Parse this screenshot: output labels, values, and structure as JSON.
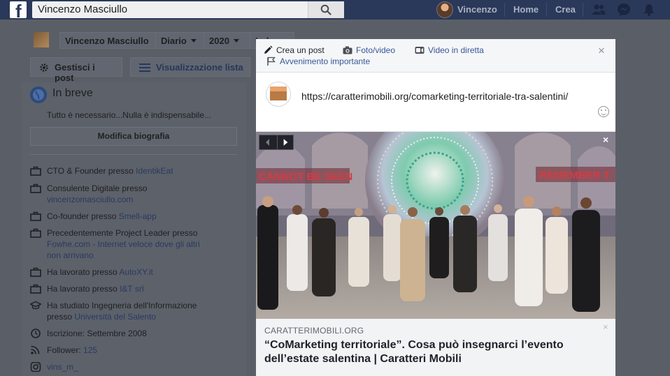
{
  "topbar": {
    "search_value": "Vincenzo Masciullo",
    "user_name": "Vincenzo",
    "home": "Home",
    "create": "Crea"
  },
  "profile": {
    "name": "Vincenzo Masciullo",
    "timeline": "Diario",
    "year": "2020",
    "more": "Ind",
    "manage_posts": "Gestisci i post",
    "list_view": "Visualizzazione lista"
  },
  "intro": {
    "title": "In breve",
    "bio": "Tutto è necessario...Nulla è indispensabile...",
    "edit_bio": "Modifica biografia",
    "items": [
      {
        "icon": "briefcase-icon",
        "text": "CTO & Founder presso ",
        "link": "IdentikEat"
      },
      {
        "icon": "briefcase-icon",
        "text": "Consulente Digitale presso",
        "link": "vincenzomasciullo.com"
      },
      {
        "icon": "briefcase-icon",
        "text": "Co-founder presso ",
        "link": "Smell-app"
      },
      {
        "icon": "briefcase-icon",
        "text": "Precedentemente Project Leader presso",
        "link": "Fowhe.com - Internet veloce dove gli altri non arrivano"
      },
      {
        "icon": "briefcase-icon",
        "text": "Ha lavorato presso ",
        "link": "AutoXY.it"
      },
      {
        "icon": "briefcase-icon",
        "text": "Ha lavorato presso ",
        "link": "I&T srl"
      },
      {
        "icon": "graduation-cap-icon",
        "text": "Ha studiato Ingegneria dell'Informazione presso ",
        "link": "Università del Salento"
      },
      {
        "icon": "clock-icon",
        "text": "Iscrizione: Settembre 2008",
        "link": ""
      },
      {
        "icon": "rss-icon",
        "text": "Follower: ",
        "link": "125"
      },
      {
        "icon": "instagram-icon",
        "text": "",
        "link": "vins_m_"
      }
    ]
  },
  "composer": {
    "tabs": {
      "create_post": "Crea un post",
      "photo_video": "Foto/video",
      "live_video": "Video in diretta",
      "life_event": "Avvenimento importante"
    },
    "post_text": "https://caratterimobili.org/comarketing-territoriale-tra-salentini/",
    "close": "×"
  },
  "preview": {
    "domain": "CARATTERIMOBILI.ORG",
    "title": "“CoMarketing territoriale”. Cosa può insegnarci l’evento dell’estate salentina | Caratteri Mobili",
    "close": "×",
    "dismiss": "×",
    "image_text_left": "CANNOT BE SEEN",
    "image_text_right": "REMEMBER T"
  },
  "colors": {
    "topbar": "#2a3959",
    "overlay_bg": "#5a5f67",
    "link": "#365899",
    "preview_bg": "#f2f3f5"
  }
}
